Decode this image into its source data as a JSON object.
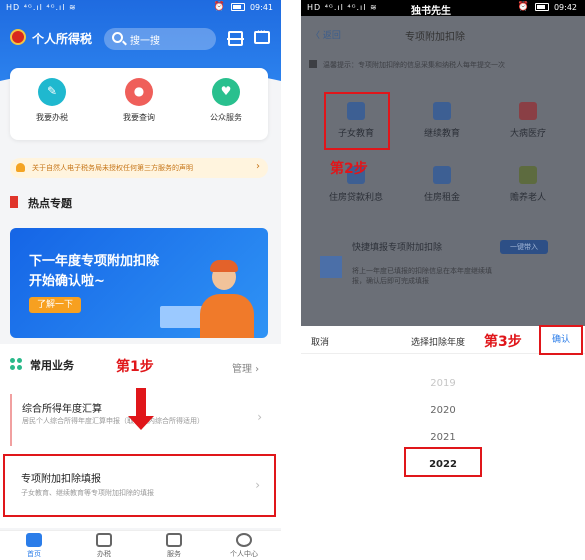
{
  "left": {
    "status": {
      "signal": "HD ⁴ᴳ.ıl ⁴ᴳ.ıl ≋",
      "alarm": "⏰",
      "time": "09:41"
    },
    "header": {
      "title": "个人所得税",
      "search_placeholder": "搜一搜"
    },
    "quick_actions": [
      {
        "label": "我要办税",
        "color": "#1fb8cf",
        "glyph": "✎"
      },
      {
        "label": "我要查询",
        "color": "#ef5f5a",
        "glyph": "●"
      },
      {
        "label": "公众服务",
        "color": "#29c08e",
        "glyph": "♥"
      }
    ],
    "notice": "关于自然人电子税务局未授权任何第三方服务的声明",
    "hot_title": "热点专题",
    "banner": {
      "line1": "下一年度专项附加扣除",
      "line2": "开始确认啦~",
      "button": "了解一下"
    },
    "common": {
      "title": "常用业务",
      "manage": "管理"
    },
    "step1": "第1步",
    "items": [
      {
        "title": "综合所得年度汇算",
        "sub": "居民个人综合所得年度汇算申报（取得境内综合所得适用）"
      },
      {
        "title": "专项附加扣除填报",
        "sub": "子女教育、继续教育等专项附加扣除的填报"
      }
    ],
    "tabs": [
      {
        "label": "首页",
        "active": true
      },
      {
        "label": "办税",
        "active": false
      },
      {
        "label": "服务",
        "active": false
      },
      {
        "label": "个人中心",
        "active": false
      }
    ]
  },
  "right": {
    "status": {
      "signal": "HD ⁴ᴳ.ıl ⁴ᴳ.ıl ≋",
      "center": "独书先生",
      "alarm": "⏰",
      "time": "09:42"
    },
    "nav": {
      "back": "〈 返回",
      "title": "专项附加扣除"
    },
    "tip": "温馨提示：专项附加扣除的信息采集和纳税人每年提交一次",
    "grid": [
      {
        "label": "子女教育"
      },
      {
        "label": "继续教育"
      },
      {
        "label": "大病医疗"
      },
      {
        "label": "住房贷款利息"
      },
      {
        "label": "住房租金"
      },
      {
        "label": "赡养老人"
      }
    ],
    "step2": "第2步",
    "quick_fill": {
      "title": "快捷填报专项附加扣除",
      "desc": "将上一年度已填报的扣除信息在本年度继续填报，确认后即可完成填报",
      "button": "一键带入"
    },
    "sheet": {
      "cancel": "取消",
      "title": "选择扣除年度",
      "confirm": "确认"
    },
    "step3": "第3步",
    "years": [
      "2019",
      "2020",
      "2021",
      "2022"
    ]
  }
}
